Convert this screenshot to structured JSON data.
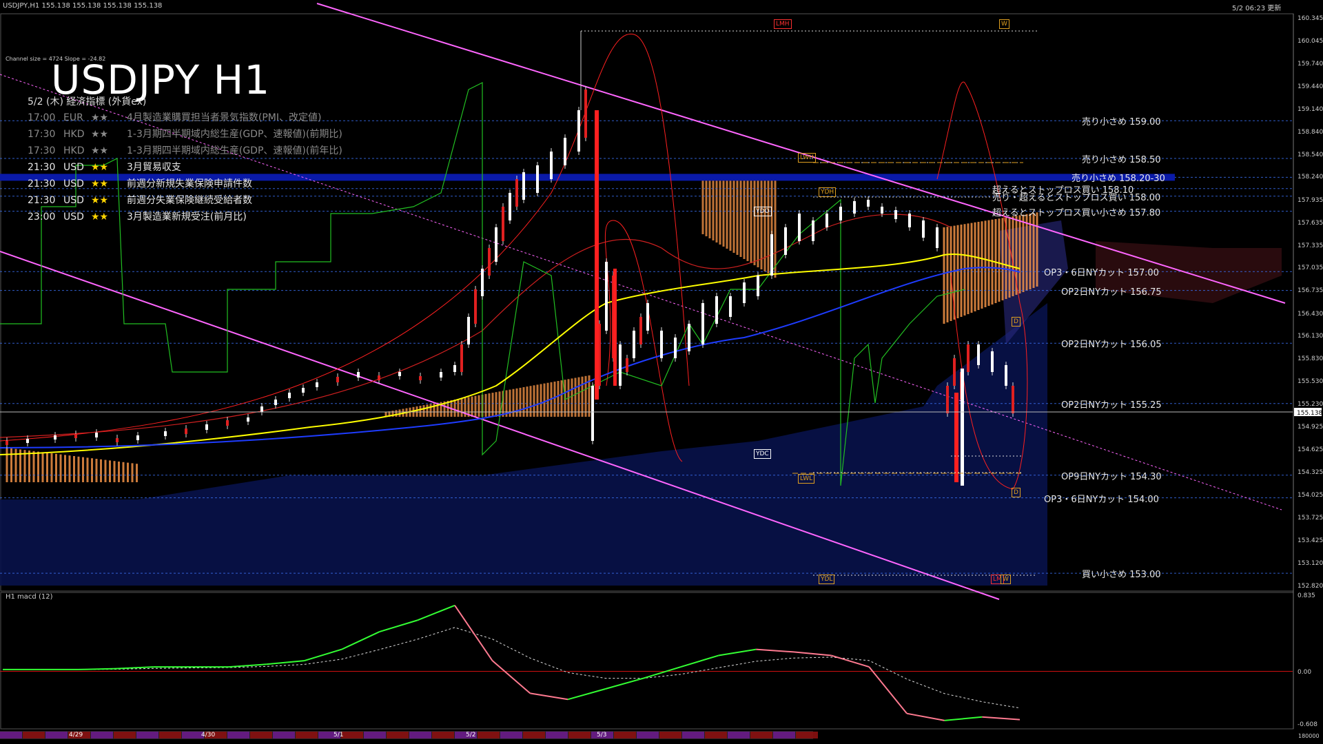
{
  "header": {
    "symbol_info": "USDJPY,H1  155.138 155.138 155.138 155.138",
    "updated": "5/2 06:23 更新",
    "channel_info": "Channel size = 4724 Slope = -24.82"
  },
  "chart_title": "USDJPY H1",
  "events_header": "5/2 (木) 経済指標 (外貨ex)",
  "events": [
    {
      "time": "17:00",
      "ccy": "EUR",
      "stars": "★★",
      "name": "4月製造業購買担当者景気指数(PMI、改定値)"
    },
    {
      "time": "17:30",
      "ccy": "HKD",
      "stars": "★★",
      "name": "1-3月期四半期域内総生産(GDP、速報値)(前期比)"
    },
    {
      "time": "17:30",
      "ccy": "HKD",
      "stars": "★★",
      "name": "1-3月期四半期域内総生産(GDP、速報値)(前年比)"
    },
    {
      "time": "21:30",
      "ccy": "USD",
      "stars": "★★",
      "name": "3月貿易収支"
    },
    {
      "time": "21:30",
      "ccy": "USD",
      "stars": "★★",
      "name": "前週分新規失業保険申請件数"
    },
    {
      "time": "21:30",
      "ccy": "USD",
      "stars": "★★",
      "name": "前週分失業保険継続受給者数"
    },
    {
      "time": "23:00",
      "ccy": "USD",
      "stars": "★★",
      "name": "3月製造業新規受注(前月比)"
    }
  ],
  "levels": [
    {
      "label": "売り小さめ 159.00",
      "price": 159.0
    },
    {
      "label": "売り小さめ 158.50",
      "price": 158.5
    },
    {
      "label": "売り小さめ 158.20-30",
      "price": 158.25
    },
    {
      "label": "超えるとストップロス買い 158.10",
      "price": 158.1
    },
    {
      "label": "売り・超えるとストップロス買い 158.00",
      "price": 158.0
    },
    {
      "label": "超えるとストップロス買い小さめ 157.80",
      "price": 157.8
    },
    {
      "label": "OP3・6日NYカット 157.00",
      "price": 157.0
    },
    {
      "label": "OP2日NYカット 156.75",
      "price": 156.75
    },
    {
      "label": "OP2日NYカット 156.05",
      "price": 156.05
    },
    {
      "label": "OP2日NYカット 155.25",
      "price": 155.25
    },
    {
      "label": "OP9日NYカット 154.30",
      "price": 154.3
    },
    {
      "label": "OP3・6日NYカット 154.00",
      "price": 154.0
    },
    {
      "label": "買い小さめ 153.00",
      "price": 153.0
    }
  ],
  "markers": [
    "LMH",
    "W",
    "LWH",
    "YDH",
    "YDO",
    "YDC",
    "LWL",
    "YDL",
    "D",
    "D",
    "LM",
    "W"
  ],
  "price_axis": [
    "160.345",
    "160.045",
    "159.740",
    "159.440",
    "159.140",
    "158.840",
    "158.540",
    "158.240",
    "157.935",
    "157.635",
    "157.335",
    "157.035",
    "156.735",
    "156.430",
    "156.130",
    "155.830",
    "155.530",
    "155.230",
    "154.925",
    "154.625",
    "154.325",
    "154.025",
    "153.725",
    "153.425",
    "153.120",
    "152.820"
  ],
  "current_price": "155.138",
  "macd": {
    "title": "H1  macd (12)",
    "axis": [
      "0.835",
      "0.00",
      "-0.608"
    ],
    "ylim": [
      -0.608,
      0.835
    ]
  },
  "time_axis": [
    "4/29",
    "4/30",
    "5/1",
    "5/2",
    "5/3"
  ],
  "time_axis_right": "180000",
  "colors": {
    "ma_short": "#ffff00",
    "ma_long": "#1e3cff",
    "channel": "#ff66ff",
    "bollinger": "#ff2020",
    "ichimoku": "#ff9a4a",
    "macd_up": "#33ff33",
    "macd_down": "#ff7a90"
  },
  "chart_data": {
    "type": "line",
    "title": "USDJPY H1",
    "ylim": [
      152.8,
      160.4
    ],
    "levels": [
      159.0,
      158.5,
      158.25,
      158.1,
      158.0,
      157.8,
      157.0,
      156.75,
      156.05,
      155.25,
      154.3,
      154.0,
      153.0
    ],
    "current": 155.138,
    "series": [
      {
        "name": "macd (12)",
        "values": [
          0.02,
          0.02,
          0.02,
          0.03,
          0.05,
          0.05,
          0.05,
          0.08,
          0.12,
          0.25,
          0.45,
          0.58,
          0.75,
          0.12,
          -0.25,
          -0.32,
          -0.2,
          -0.08,
          0.05,
          0.18,
          0.25,
          0.22,
          0.18,
          0.05,
          -0.48,
          -0.56,
          -0.52,
          -0.55
        ]
      }
    ]
  }
}
